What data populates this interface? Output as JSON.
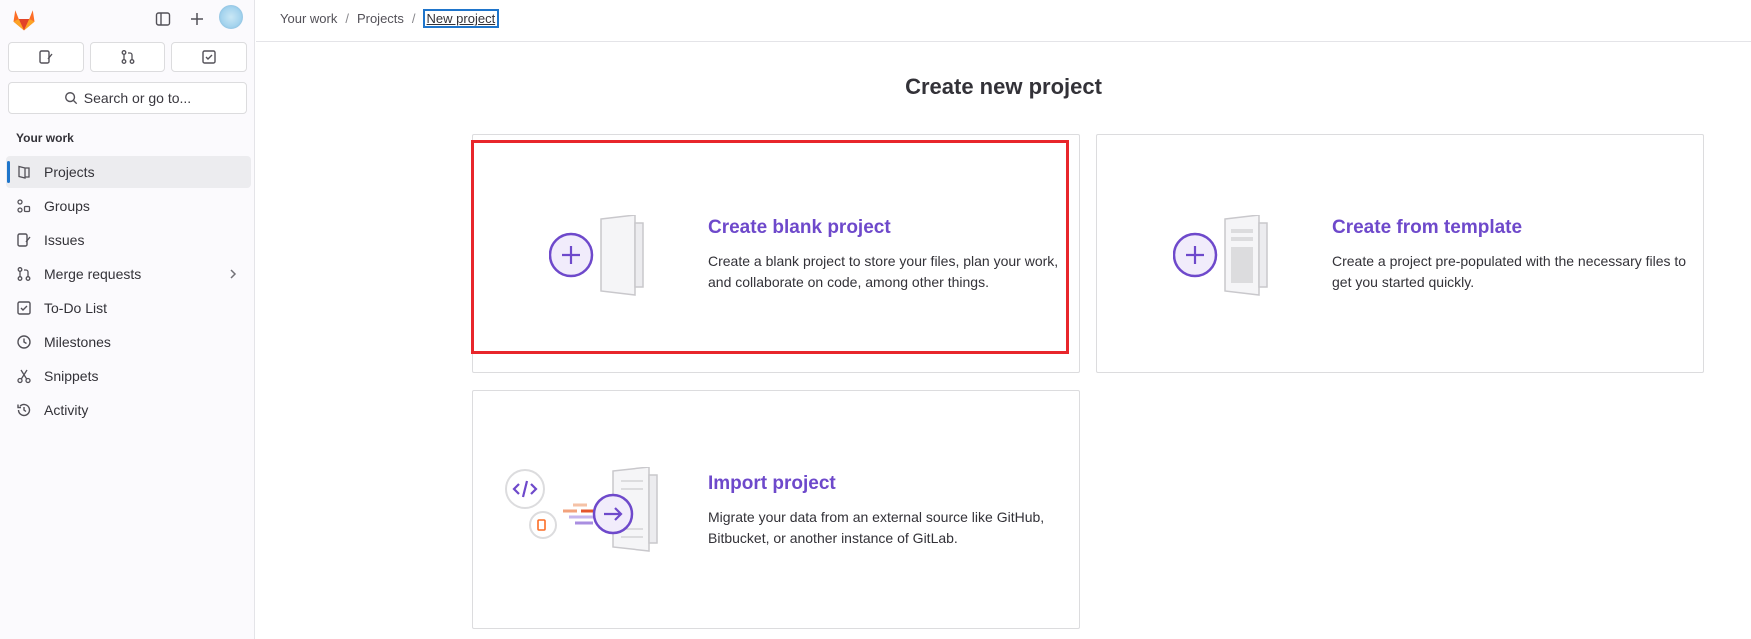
{
  "sidebar": {
    "search_label": "Search or go to...",
    "section_title": "Your work",
    "items": [
      {
        "label": "Projects",
        "icon": "project-icon",
        "active": true
      },
      {
        "label": "Groups",
        "icon": "group-icon"
      },
      {
        "label": "Issues",
        "icon": "issues-icon"
      },
      {
        "label": "Merge requests",
        "icon": "merge-request-icon",
        "expandable": true
      },
      {
        "label": "To-Do List",
        "icon": "todo-icon"
      },
      {
        "label": "Milestones",
        "icon": "clock-icon"
      },
      {
        "label": "Snippets",
        "icon": "snippet-icon"
      },
      {
        "label": "Activity",
        "icon": "history-icon"
      }
    ]
  },
  "breadcrumb": {
    "items": [
      "Your work",
      "Projects",
      "New project"
    ],
    "separator": "/"
  },
  "page": {
    "title": "Create new project"
  },
  "cards": [
    {
      "title": "Create blank project",
      "description": "Create a blank project to store your files, plan your work, and collaborate on code, among other things.",
      "icon": "blank-project-illustration",
      "highlighted": true
    },
    {
      "title": "Create from template",
      "description": "Create a project pre-populated with the necessary files to get you started quickly.",
      "icon": "template-project-illustration"
    },
    {
      "title": "Import project",
      "description": "Migrate your data from an external source like GitHub, Bitbucket, or another instance of GitLab.",
      "icon": "import-project-illustration"
    }
  ],
  "colors": {
    "accent": "#6e49cb",
    "highlight": "#e8262b",
    "active_indicator": "#1f75cb",
    "gitlab_orange": "#fc6d26"
  }
}
